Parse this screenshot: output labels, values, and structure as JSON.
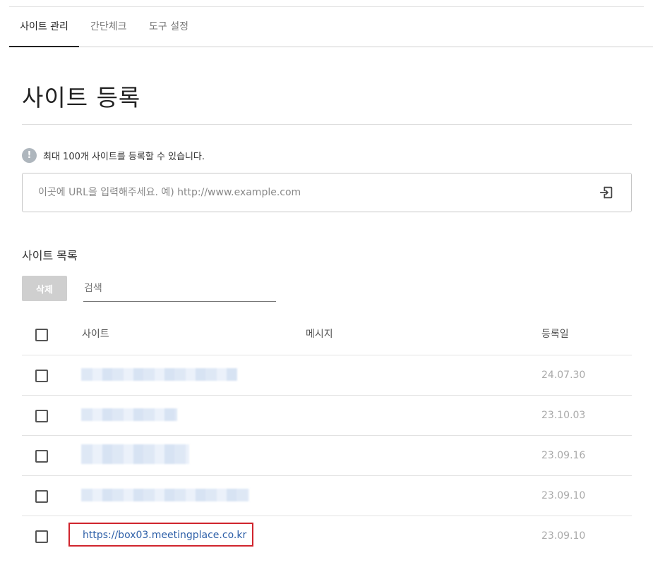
{
  "tabs": [
    {
      "label": "사이트 관리",
      "active": true
    },
    {
      "label": "간단체크",
      "active": false
    },
    {
      "label": "도구 설정",
      "active": false
    }
  ],
  "page_title": "사이트 등록",
  "notice": {
    "icon": "info-icon",
    "text": "최대 100개 사이트를 등록할 수 있습니다."
  },
  "url_input": {
    "placeholder": "이곳에 URL을 입력해주세요. 예) http://www.example.com",
    "value": "",
    "submit_icon": "enter-icon"
  },
  "site_list": {
    "title": "사이트 목록",
    "delete_label": "삭제",
    "search_placeholder": "검색",
    "columns": {
      "site": "사이트",
      "message": "메시지",
      "date": "등록일"
    },
    "rows": [
      {
        "site": "",
        "blurred": true,
        "message": "",
        "date": "24.07.30"
      },
      {
        "site": "",
        "blurred": true,
        "message": "",
        "date": "23.10.03"
      },
      {
        "site": "",
        "blurred": true,
        "message": "",
        "date": "23.09.16"
      },
      {
        "site": "",
        "blurred": true,
        "message": "",
        "date": "23.09.10"
      },
      {
        "site": "https://box03.meetingplace.co.kr",
        "blurred": false,
        "highlighted": true,
        "message": "",
        "date": "23.09.10"
      }
    ]
  },
  "colors": {
    "accent_text": "#222222",
    "link": "#2d5fa8",
    "highlight_border": "#d0242d",
    "disabled_button": "#cfcfcf"
  }
}
